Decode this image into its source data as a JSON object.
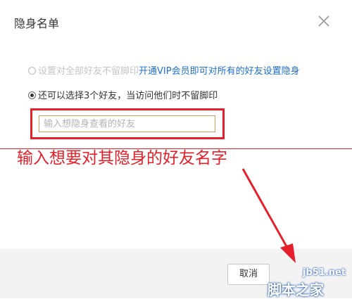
{
  "dialog": {
    "title": "隐身名单",
    "close_icon": "close-icon"
  },
  "options": {
    "all_friends": {
      "text": "设置对全部好友不留脚印",
      "link": "开通VIP会员即可对所有的好友设置隐身",
      "selected": false,
      "disabled": true
    },
    "select_friends": {
      "text": "还可以选择3个好友，当访问他们时不留脚印",
      "selected": true
    }
  },
  "friend_input": {
    "placeholder": "输入想隐身查看的好友",
    "value": ""
  },
  "annotation": {
    "text": "输入想要对其隐身的好友名字",
    "color": "#e5202a"
  },
  "footer": {
    "cancel_label": "取消"
  },
  "watermark": {
    "url": "jb51.net",
    "text": "脚本之家"
  }
}
